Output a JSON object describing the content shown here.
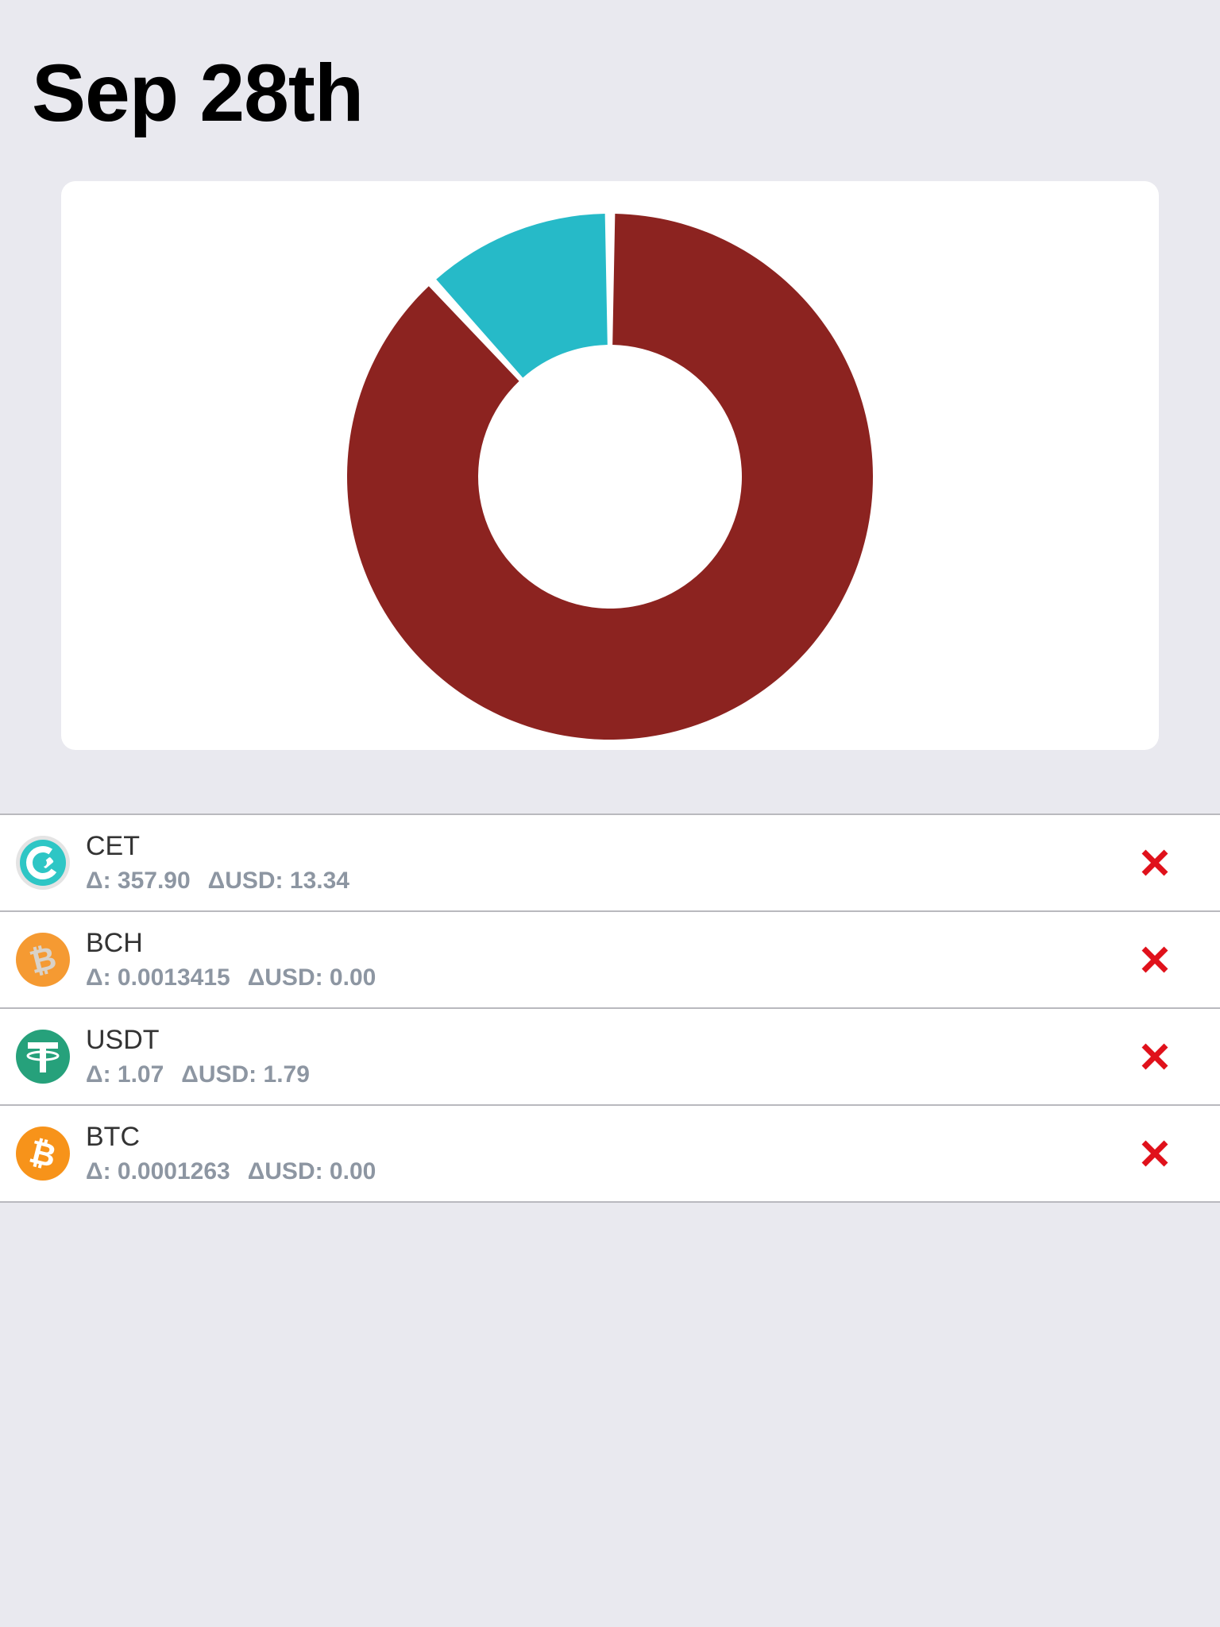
{
  "header": {
    "title": "Sep 28th"
  },
  "chart_data": {
    "type": "pie",
    "variant": "donut",
    "slices": [
      {
        "label": "CET",
        "percent": 88.2,
        "color": "#8c2320"
      },
      {
        "label": "USDT",
        "percent": 11.8,
        "color": "#26bac8"
      }
    ]
  },
  "assets": [
    {
      "symbol": "CET",
      "delta": "Δ: 357.90",
      "delta_usd": "ΔUSD: 13.34",
      "icon": "coinex-icon"
    },
    {
      "symbol": "BCH",
      "delta": "Δ: 0.0013415",
      "delta_usd": "ΔUSD: 0.00",
      "icon": "bitcoin-cash-icon"
    },
    {
      "symbol": "USDT",
      "delta": "Δ: 1.07",
      "delta_usd": "ΔUSD: 1.79",
      "icon": "tether-icon"
    },
    {
      "symbol": "BTC",
      "delta": "Δ: 0.0001263",
      "delta_usd": "ΔUSD: 0.00",
      "icon": "bitcoin-icon"
    }
  ],
  "colors": {
    "background": "#e9e9ef",
    "delete": "#e0111b",
    "delta_text": "#8d96a2",
    "coinex": "#2ec6c5",
    "bitcoin_cash": "#f59a32",
    "tether": "#26a17b",
    "bitcoin": "#f7931a"
  }
}
